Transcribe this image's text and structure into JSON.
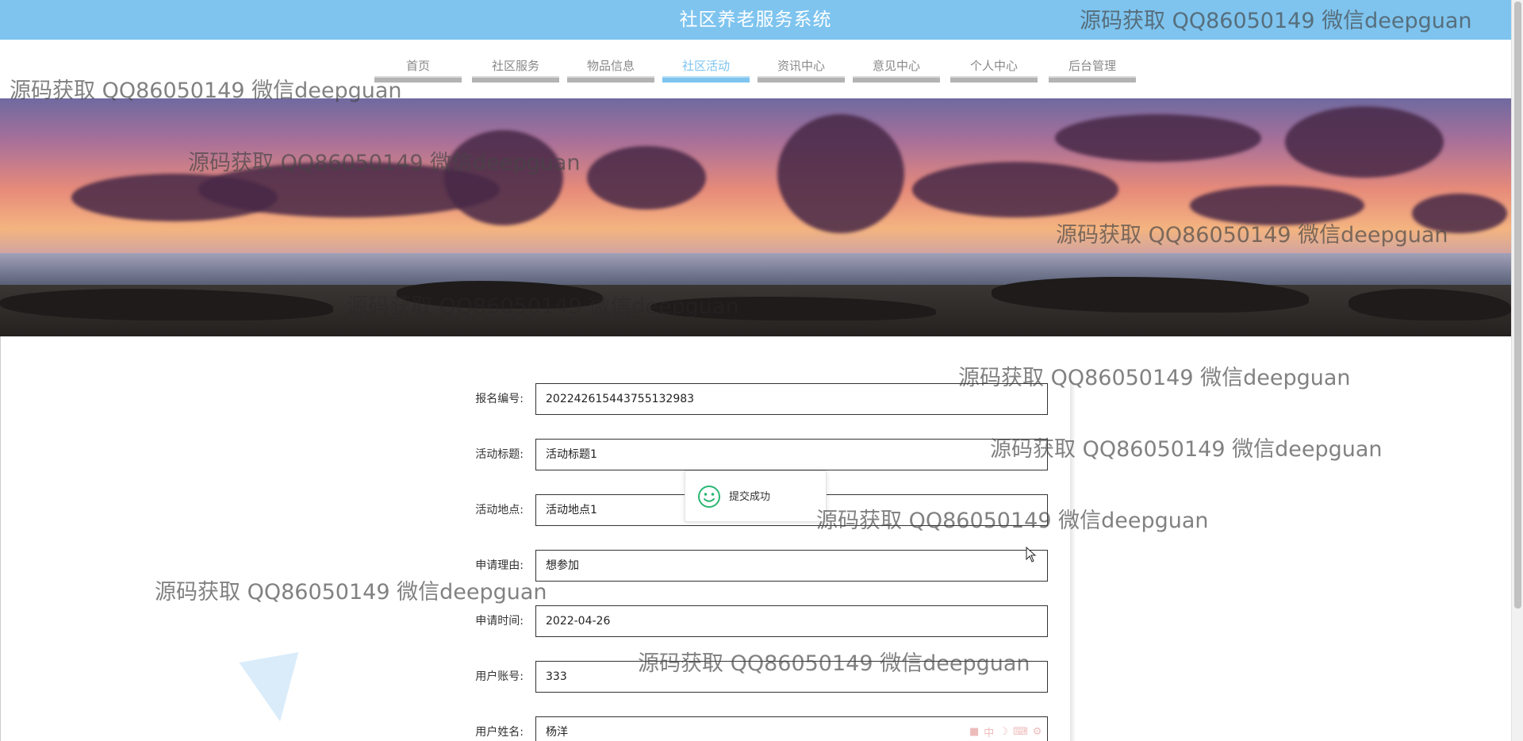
{
  "header": {
    "title": "社区养老服务系统"
  },
  "nav": {
    "items": [
      {
        "label": "首页"
      },
      {
        "label": "社区服务"
      },
      {
        "label": "物品信息"
      },
      {
        "label": "社区活动"
      },
      {
        "label": "资讯中心"
      },
      {
        "label": "意见中心"
      },
      {
        "label": "个人中心"
      },
      {
        "label": "后台管理"
      }
    ],
    "active": "社区活动",
    "active_color": "#7ec4ef"
  },
  "form": {
    "fields": [
      {
        "label": "报名编号:",
        "value": "202242615443755132983"
      },
      {
        "label": "活动标题:",
        "value": "活动标题1"
      },
      {
        "label": "活动地点:",
        "value": "活动地点1"
      },
      {
        "label": "申请理由:",
        "value": "想参加"
      },
      {
        "label": "申请时间:",
        "value": "2022-04-26"
      },
      {
        "label": "用户账号:",
        "value": "333"
      },
      {
        "label": "用户姓名:",
        "value": "杨洋"
      }
    ]
  },
  "toast": {
    "message": "提交成功",
    "icon": "smile-icon",
    "color": "#2bb673"
  },
  "watermark": "源码获取 QQ86050149 微信deepguan",
  "ime": {
    "label": "中"
  },
  "colors": {
    "header_bg": "#7ec4ef",
    "nav_inactive": "#888888"
  }
}
